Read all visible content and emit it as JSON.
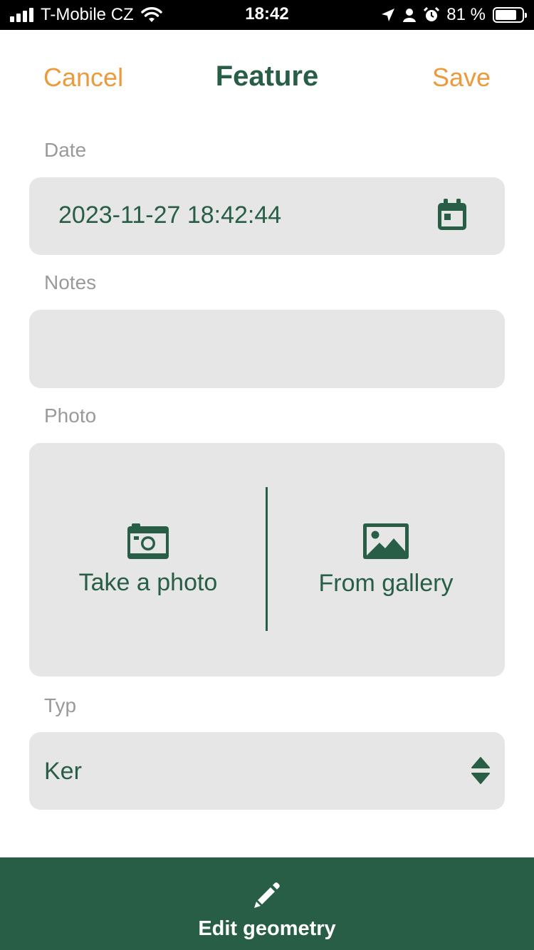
{
  "status_bar": {
    "carrier": "T-Mobile CZ",
    "time": "18:42",
    "battery": "81 %",
    "battery_level": 0.81
  },
  "header": {
    "cancel": "Cancel",
    "title": "Feature",
    "save": "Save"
  },
  "form": {
    "date_label": "Date",
    "date_value": "2023-11-27 18:42:44",
    "notes_label": "Notes",
    "notes_value": "",
    "photo_label": "Photo",
    "take_photo": "Take a photo",
    "from_gallery": "From gallery",
    "typ_label": "Typ",
    "typ_value": "Ker"
  },
  "bottom": {
    "edit_geometry": "Edit geometry"
  },
  "colors": {
    "accent_green": "#285e46",
    "accent_orange": "#ec9a3c",
    "field_bg": "#e6e6e6",
    "label_gray": "#9a9a9a"
  },
  "icons": [
    "signal-icon",
    "wifi-icon",
    "location-arrow-icon",
    "person-icon",
    "alarm-icon",
    "battery-icon",
    "calendar-icon",
    "camera-icon",
    "image-icon",
    "sort-icon",
    "pencil-icon"
  ]
}
